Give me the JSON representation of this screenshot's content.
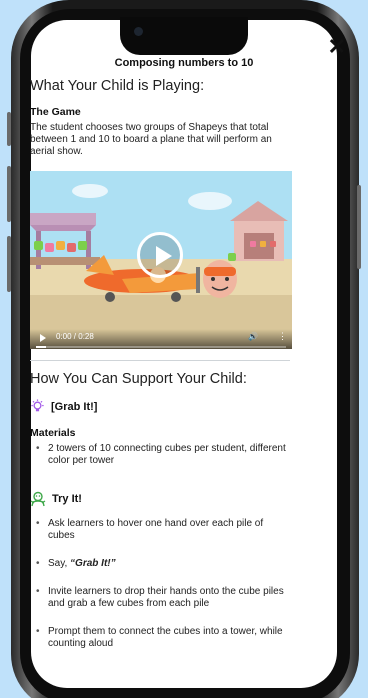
{
  "modal": {
    "title": "Composing numbers to 10",
    "close_label": "✕"
  },
  "playing": {
    "heading": "What Your Child is Playing:",
    "game_label": "The Game",
    "game_text": "The student chooses two groups of Shapeys that total between 1 and 10 to board a plane that will perform an aerial show."
  },
  "video": {
    "time": "0:00 / 0:28",
    "volume_icon": "volume-icon",
    "more_icon": "more-options-icon",
    "progress": 0.04
  },
  "support": {
    "heading": "How You Can Support Your Child:",
    "activity_title": "[Grab It!]",
    "materials_label": "Materials",
    "materials": [
      "2 towers of 10 connecting cubes per student, different color per tower"
    ],
    "try_label": "Try It!",
    "steps": [
      "Ask learners to hover one hand over each pile of cubes",
      "Invite learners to drop their hands onto the cube piles and grab a few cubes from each pile",
      "Prompt them to connect the cubes into a tower, while counting aloud"
    ],
    "say_prefix": "Say, ",
    "say_quote": "“Grab It!”"
  },
  "colors": {
    "background": "#bfe1fa",
    "bulb_icon": "#a259e8",
    "try_icon": "#3fa84a",
    "plane_body": "#ef6a2c",
    "plane_wing": "#f39a3b"
  }
}
